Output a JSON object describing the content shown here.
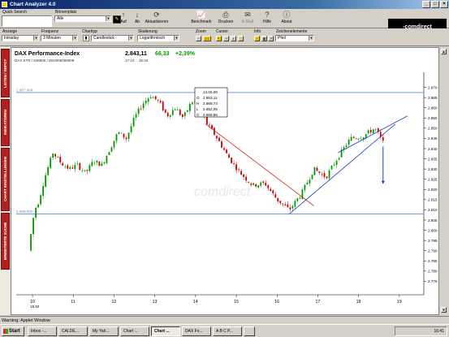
{
  "window": {
    "title": "Chart Analyzer 4.0",
    "min": "_",
    "max": "□",
    "close": "×"
  },
  "toolbar": {
    "quick_search_label": "Quick Search",
    "quick_search_value": "",
    "exchange_label": "Börsenplatz",
    "exchange_value": "Alle",
    "buttons": [
      {
        "label": "Auf",
        "icon": "arrow-up-icon",
        "glyph": "↑"
      },
      {
        "label": "Ab",
        "icon": "arrow-down-icon",
        "glyph": "↓"
      },
      {
        "label": "Aktualisieren",
        "icon": "refresh-icon",
        "glyph": "⟳"
      },
      {
        "label": "Benchmark",
        "icon": "chart-icon",
        "glyph": "📈"
      },
      {
        "label": "Drucken",
        "icon": "printer-icon",
        "glyph": "⎙"
      },
      {
        "label": "E-Mail",
        "icon": "email-icon",
        "glyph": "✉"
      },
      {
        "label": "Hilfe",
        "icon": "help-icon",
        "glyph": "?"
      },
      {
        "label": "About",
        "icon": "info-icon",
        "glyph": "ⓘ"
      }
    ],
    "brand": "-comdirect"
  },
  "settings": {
    "anzeige_label": "Anzeige",
    "anzeige_value": "Intraday",
    "frequenz_label": "Frequenz",
    "frequenz_value": "3 Minuten",
    "charttyp_label": "Charttyp",
    "charttyp_value": "Candlestick",
    "skalierung_label": "Skalierung",
    "skalierung_value": "Logarithmisch",
    "zoom_label": "Zoom",
    "zoom_value": "1:1",
    "cursor_label": "Cursor",
    "info_label": "Info",
    "zeichen_label": "Zeichenelemente",
    "zeichen_value": "Pfeil"
  },
  "sidebar": {
    "tabs": [
      "LISTEN / DEPOT",
      "INDIKATOREN",
      "CHART EINSTELLUNGEN",
      "ERWEITERTE SUCHE"
    ]
  },
  "instrument": {
    "name": "DAX Performance-Index",
    "price": "2.843,11",
    "change": "66,33",
    "change_pct": "+2,39%",
    "ids": "DAX ETR / 846900 / DE0008469008",
    "time": "17:24",
    "date": "16.04",
    "watermark": "comdirect"
  },
  "ohlc_box": {
    "date": "13.06.00",
    "o": "2.853,11",
    "h": "2.866,74",
    "l": "2.852,05",
    "c": "2.866,86"
  },
  "hlines": {
    "upper": "2.867,484",
    "lower": "2.808,000"
  },
  "colors": {
    "up": "#009a00",
    "down": "#cc0000",
    "hline": "#5b8fd6",
    "trend_red": "#d02020",
    "trend_blue": "#2040c0",
    "arrow": "#1a3fd0"
  },
  "chart_data": {
    "type": "candlestick",
    "xlabel": "",
    "ylabel": "",
    "ylim": [
      2770,
      2875
    ],
    "y_ticks": [
      "2.870",
      "2.865",
      "2.860",
      "2.855",
      "2.850",
      "2.845",
      "2.840",
      "2.835",
      "2.830",
      "2.825",
      "2.820",
      "2.815",
      "2.810",
      "2.805",
      "2.800",
      "2.795",
      "2.790",
      "2.785",
      "2.780",
      "2.775"
    ],
    "x_ticks": [
      {
        "label": "10",
        "sub": "15.04",
        "t": 0
      },
      {
        "label": "11",
        "sub": "",
        "t": 1
      },
      {
        "label": "12",
        "sub": "",
        "t": 2
      },
      {
        "label": "13",
        "sub": "",
        "t": 3
      },
      {
        "label": "14",
        "sub": "",
        "t": 4
      },
      {
        "label": "15",
        "sub": "",
        "t": 5
      },
      {
        "label": "16",
        "sub": "",
        "t": 6
      },
      {
        "label": "17",
        "sub": "",
        "t": 7
      },
      {
        "label": "18",
        "sub": "",
        "t": 8
      },
      {
        "label": "19",
        "sub": "",
        "t": 9
      }
    ],
    "path": [
      [
        -0.1,
        2790
      ],
      [
        0.05,
        2810
      ],
      [
        0.15,
        2814
      ],
      [
        0.3,
        2826
      ],
      [
        0.5,
        2838
      ],
      [
        0.7,
        2833
      ],
      [
        0.9,
        2830
      ],
      [
        1.1,
        2832
      ],
      [
        1.3,
        2828
      ],
      [
        1.5,
        2834
      ],
      [
        1.7,
        2832
      ],
      [
        1.9,
        2840
      ],
      [
        2.1,
        2848
      ],
      [
        2.3,
        2845
      ],
      [
        2.5,
        2855
      ],
      [
        2.7,
        2862
      ],
      [
        2.9,
        2866
      ],
      [
        3.1,
        2863
      ],
      [
        3.3,
        2856
      ],
      [
        3.5,
        2860
      ],
      [
        3.7,
        2855
      ],
      [
        3.9,
        2863
      ],
      [
        4.1,
        2862
      ],
      [
        4.25,
        2853
      ],
      [
        4.5,
        2846
      ],
      [
        4.8,
        2836
      ],
      [
        5.1,
        2828
      ],
      [
        5.4,
        2822
      ],
      [
        5.7,
        2823
      ],
      [
        6.0,
        2815
      ],
      [
        6.3,
        2810
      ],
      [
        6.6,
        2818
      ],
      [
        6.9,
        2830
      ],
      [
        7.2,
        2826
      ],
      [
        7.5,
        2836
      ],
      [
        7.8,
        2845
      ],
      [
        8.1,
        2846
      ],
      [
        8.4,
        2850
      ],
      [
        8.6,
        2843
      ]
    ],
    "lines": [
      {
        "name": "",
        "color": "red",
        "points": [
          [
            4.25,
            2852
          ],
          [
            6.9,
            2812
          ]
        ]
      },
      {
        "name": "",
        "color": "blue",
        "points": [
          [
            6.3,
            2808
          ],
          [
            8.9,
            2852
          ]
        ]
      },
      {
        "name": "",
        "color": "blue",
        "points": [
          [
            7.5,
            2838
          ],
          [
            9.2,
            2856
          ]
        ]
      }
    ],
    "arrow": {
      "t": 8.6,
      "from": 2841,
      "to": 2823
    }
  },
  "status": {
    "warning": "Warning: Applet Window"
  },
  "taskbar": {
    "start": "Start",
    "tasks": [
      "Inbox -...",
      "CALDE...",
      "My Yah...",
      "Chart ...",
      "Chart ...",
      "DAX Fo...",
      "A B C P...",
      ""
    ],
    "clock": "16:41"
  }
}
